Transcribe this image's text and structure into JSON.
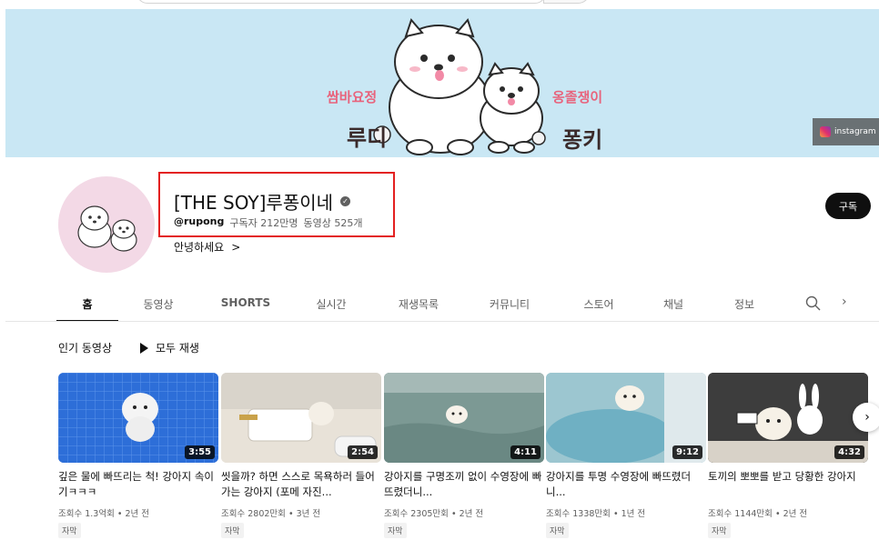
{
  "banner": {
    "subtitle_left": "쌈바요정",
    "name_left": "루디",
    "subtitle_right": "옹졸쟁이",
    "name_right": "퐁키",
    "instagram_label": "instagram"
  },
  "channel": {
    "title": "[THE SOY]루퐁이네",
    "handle": "@rupong",
    "subscribers": "구독자 212만명",
    "video_count": "동영상 525개",
    "description": "안녕하세요",
    "desc_chevron": ">",
    "subscribe_label": "구독"
  },
  "tabs": [
    {
      "label": "홈"
    },
    {
      "label": "동영상"
    },
    {
      "label": "SHORTS"
    },
    {
      "label": "실시간"
    },
    {
      "label": "재생목록"
    },
    {
      "label": "커뮤니티"
    },
    {
      "label": "스토어"
    },
    {
      "label": "채널"
    },
    {
      "label": "정보"
    }
  ],
  "tab_next": "›",
  "section": {
    "title": "인기 동영상",
    "play_all": "모두 재생"
  },
  "videos": [
    {
      "title": "깊은 물에 빠뜨리는 척! 강아지 속이기ㅋㅋㅋ",
      "duration": "3:55",
      "views": "조회수 1.3억회",
      "age": "2년 전",
      "badge": "자막"
    },
    {
      "title": "씻을까? 하면 스스로 목욕하러 들어가는 강아지 (포메 자진...",
      "duration": "2:54",
      "views": "조회수 2802만회",
      "age": "3년 전",
      "badge": "자막"
    },
    {
      "title": "강아지를 구명조끼 없이 수영장에 빠뜨렸더니...",
      "duration": "4:11",
      "views": "조회수 2305만회",
      "age": "2년 전",
      "badge": "자막"
    },
    {
      "title": "강아지를 투명 수영장에 빠뜨렸더니...",
      "duration": "9:12",
      "views": "조회수 1338만회",
      "age": "1년 전",
      "badge": "자막"
    },
    {
      "title": "토끼의 뽀뽀를 받고 당황한 강아지",
      "duration": "4:32",
      "views": "조회수 1144만회",
      "age": "2년 전",
      "badge": "자막"
    }
  ],
  "meta_separator": "•",
  "carousel_next": "›",
  "colors": {
    "banner_bg": "#c9e7f4",
    "highlight": "#e32020",
    "avatar_bg": "#f3d9e6"
  }
}
